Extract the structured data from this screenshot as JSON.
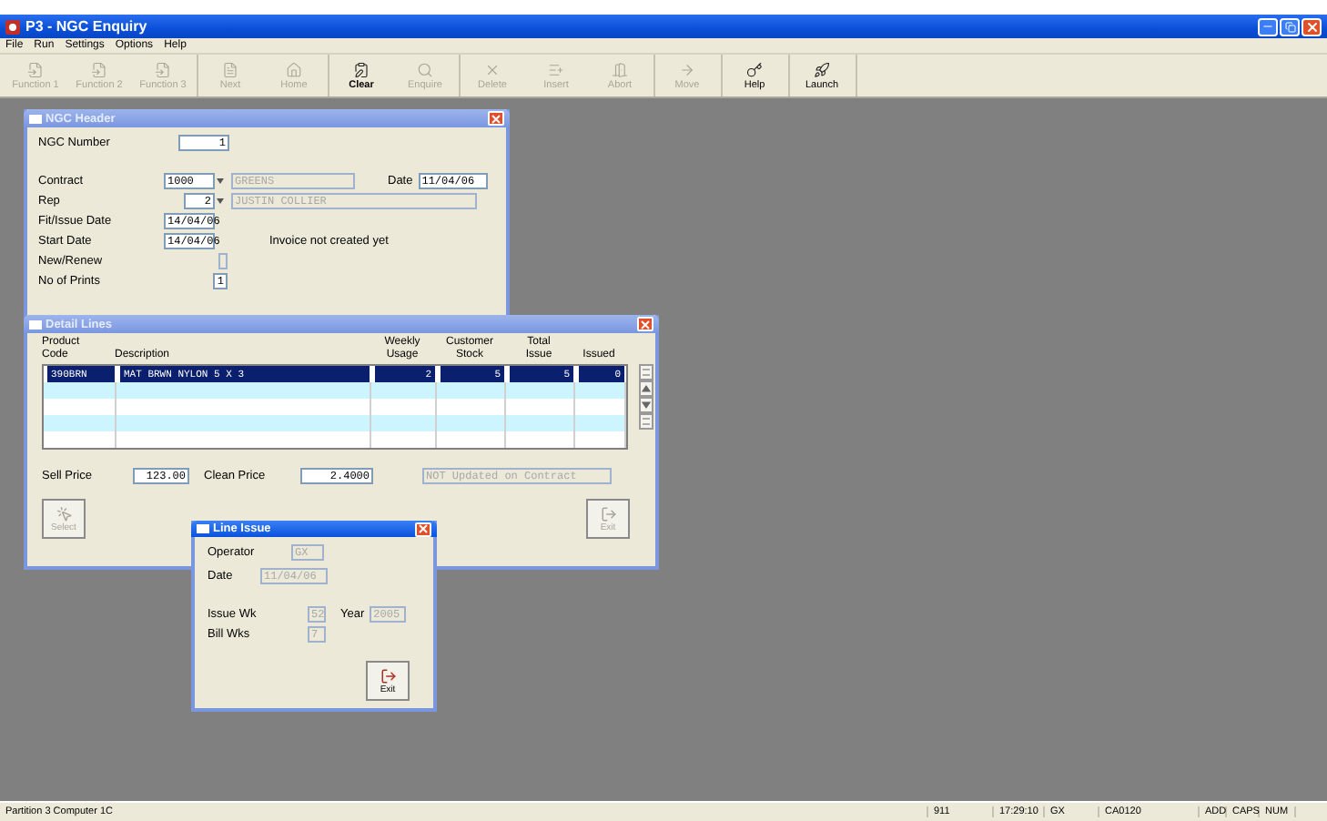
{
  "window": {
    "title": "P3 - NGC Enquiry"
  },
  "menu": [
    "File",
    "Run",
    "Settings",
    "Options",
    "Help"
  ],
  "toolbar": [
    [
      {
        "label": "Function 1",
        "kind": "function",
        "disabled": true
      },
      {
        "label": "Function 2",
        "kind": "function",
        "disabled": true
      },
      {
        "label": "Function 3",
        "kind": "function",
        "disabled": true
      }
    ],
    [
      {
        "label": "Next",
        "kind": "next",
        "disabled": true
      },
      {
        "label": "Home",
        "kind": "home",
        "disabled": true
      }
    ],
    [
      {
        "label": "Clear",
        "kind": "clear",
        "disabled": false
      },
      {
        "label": "Enquire",
        "kind": "enquire",
        "disabled": true
      }
    ],
    [
      {
        "label": "Delete",
        "kind": "delete",
        "disabled": true
      },
      {
        "label": "Insert",
        "kind": "insert",
        "disabled": true
      },
      {
        "label": "Abort",
        "kind": "abort",
        "disabled": true
      }
    ],
    [
      {
        "label": "Move",
        "kind": "move",
        "disabled": true
      }
    ],
    [
      {
        "label": "Help",
        "kind": "help",
        "disabled": false
      }
    ],
    [
      {
        "label": "Launch",
        "kind": "launch",
        "disabled": false
      }
    ]
  ],
  "ngc_header": {
    "title": "NGC Header",
    "active": false,
    "ngc_number": {
      "label": "NGC Number",
      "value": "1"
    },
    "contract": {
      "label": "Contract",
      "code": "1000",
      "name": "GREENS",
      "name_disabled": true
    },
    "date": {
      "label": "Date",
      "value": "11/04/06"
    },
    "rep": {
      "label": "Rep",
      "code": "2",
      "name": "JUSTIN COLLIER",
      "name_disabled": true
    },
    "fit_issue_date": {
      "label": "Fit/Issue Date",
      "value": "14/04/06"
    },
    "start_date": {
      "label": "Start Date",
      "value": "14/04/06"
    },
    "invoice_note": "Invoice not created yet",
    "new_renew": {
      "label": "New/Renew",
      "disabled": true
    },
    "no_of_prints": {
      "label": "No of Prints",
      "value": "1"
    }
  },
  "detail_lines": {
    "title": "Detail Lines",
    "active": false,
    "columns": [
      "Product Code",
      "Description",
      "Weekly Usage",
      "Customer Stock",
      "Total Issue",
      "Issued"
    ],
    "rows": [
      {
        "selected": true,
        "cells": [
          "390BRN",
          "MAT BRWN NYLON 5 X 3",
          "2",
          "5",
          "5",
          "0"
        ]
      }
    ],
    "sell_price": {
      "label": "Sell Price",
      "value": "123.00"
    },
    "clean_price": {
      "label": "Clean Price",
      "value": "2.4000"
    },
    "contract_status": {
      "value": "NOT Updated on Contract",
      "disabled": true
    },
    "buttons": [
      {
        "label": "Select",
        "kind": "select",
        "disabled": true
      },
      {
        "label": "Exit",
        "kind": "exit",
        "disabled": true
      }
    ]
  },
  "line_issue": {
    "title": "Line Issue",
    "active": true,
    "operator": {
      "label": "Operator",
      "value": "GX",
      "disabled": true
    },
    "date": {
      "label": "Date",
      "value": "11/04/06",
      "disabled": true
    },
    "issue_wk": {
      "label": "Issue Wk",
      "value": "52",
      "disabled": true
    },
    "year": {
      "label": "Year",
      "value": "2005",
      "disabled": true
    },
    "bill_wks": {
      "label": "Bill Wks",
      "value": "7",
      "disabled": true
    },
    "exit": {
      "label": "Exit",
      "disabled": false
    }
  },
  "status_bar": [
    "Partition 3 Computer 1C",
    "911",
    "17:29:10",
    "GX",
    "CA0120",
    "ADD",
    "CAPS",
    "NUM"
  ]
}
